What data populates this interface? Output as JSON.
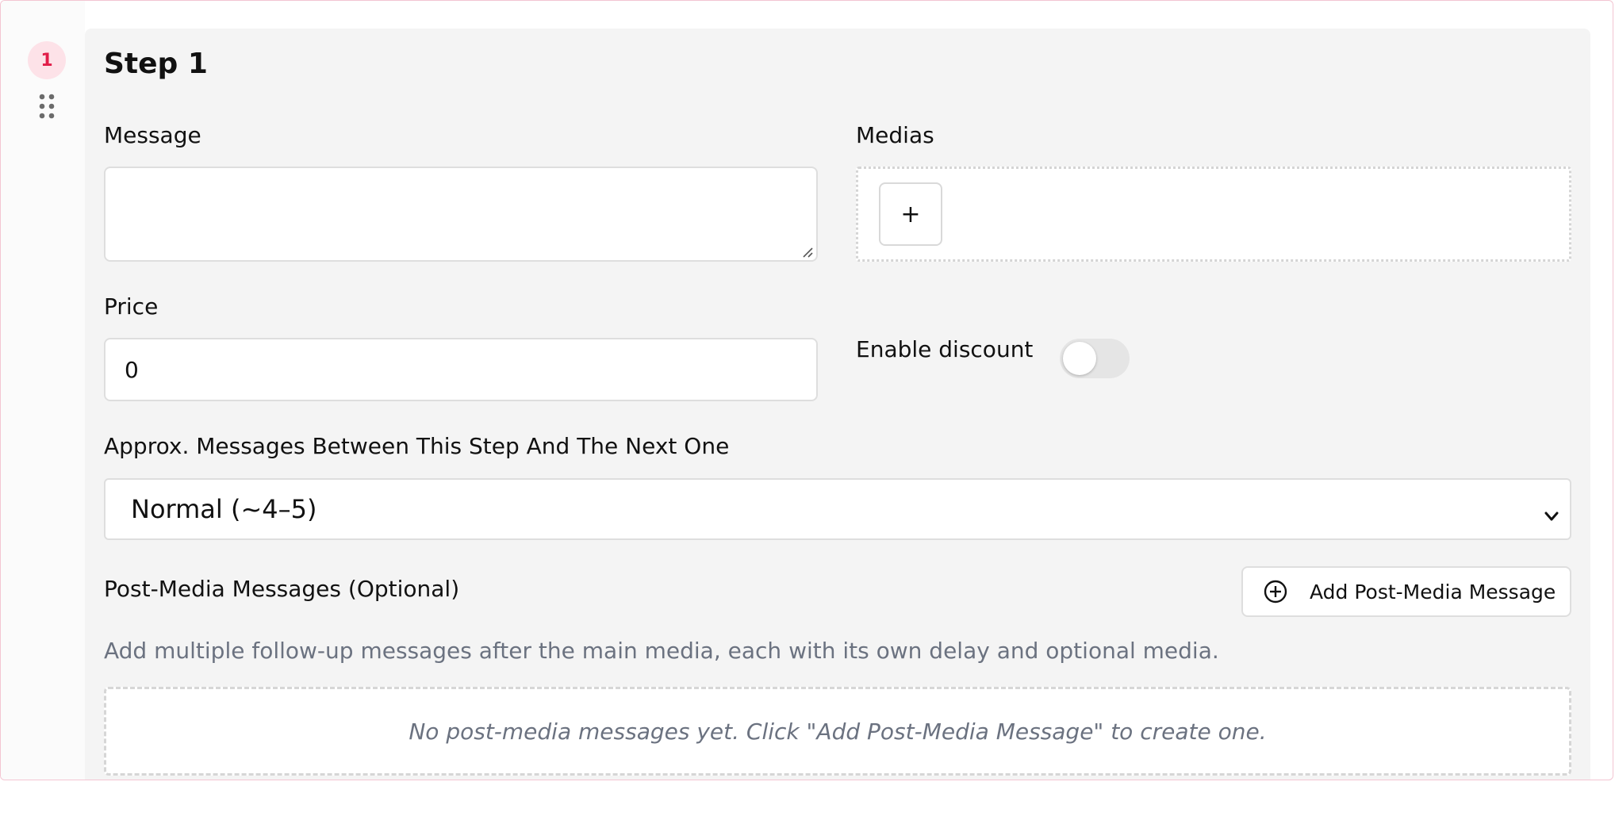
{
  "step": {
    "number": "1",
    "title": "Step 1"
  },
  "message": {
    "label": "Message",
    "value": ""
  },
  "medias": {
    "label": "Medias",
    "add_label": "+"
  },
  "price": {
    "label": "Price",
    "value": "0"
  },
  "discount": {
    "label": "Enable discount",
    "enabled": false
  },
  "spacing": {
    "label": "Approx. Messages Between This Step And The Next One",
    "selected": "Normal (~4–5)"
  },
  "post_media": {
    "label": "Post-Media Messages (Optional)",
    "add_button_label": "Add Post-Media Message",
    "hint": "Add multiple follow-up messages after the main media, each with its own delay and optional media.",
    "empty_text": "No post-media messages yet. Click \"Add Post-Media Message\" to create one."
  },
  "colors": {
    "accent": "#e11d48",
    "badge_bg": "#fde2e8",
    "card_bg": "#f4f4f4",
    "muted_text": "#6b7280"
  },
  "icons": {
    "drag": "drag-handle-icon",
    "add_circle": "plus-circle-icon",
    "chevron": "chevron-down-icon",
    "resize": "resize-grip-icon"
  }
}
